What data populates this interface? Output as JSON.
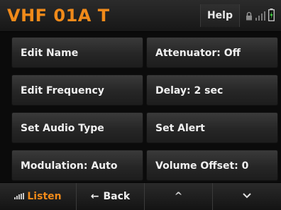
{
  "header": {
    "title": "VHF 01A T",
    "help_label": "Help",
    "icons": [
      "lock-icon",
      "signal-bars-icon",
      "battery-icon"
    ]
  },
  "menu": {
    "items": [
      {
        "label": "Edit Name"
      },
      {
        "label": "Attenuator: Off"
      },
      {
        "label": "Edit Frequency"
      },
      {
        "label": "Delay: 2 sec"
      },
      {
        "label": "Set Audio Type"
      },
      {
        "label": "Set Alert"
      },
      {
        "label": "Modulation: Auto"
      },
      {
        "label": "Volume Offset: 0"
      }
    ]
  },
  "softkeys": {
    "listen_label": "Listen",
    "back_label": "Back",
    "back_arrow": "←",
    "up_glyph": "^",
    "down_glyph": "⌄"
  },
  "colors": {
    "accent": "#f08a1a",
    "background": "#0b0b0b",
    "button": "#2b2b2b",
    "text": "#f0f0f0"
  }
}
